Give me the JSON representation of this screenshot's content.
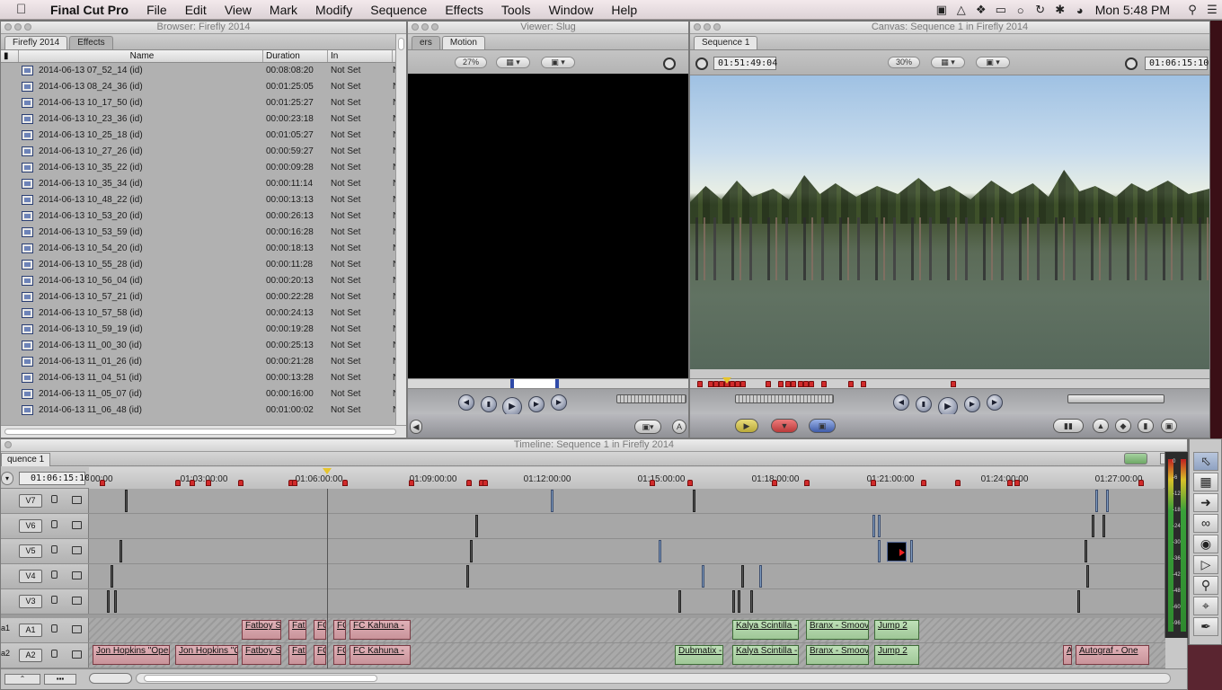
{
  "menubar": {
    "app_name": "Final Cut Pro",
    "items": [
      "File",
      "Edit",
      "View",
      "Mark",
      "Modify",
      "Sequence",
      "Effects",
      "Tools",
      "Window",
      "Help"
    ],
    "clock": "Mon 5:48 PM"
  },
  "browser": {
    "title": "Browser: Firefly 2014",
    "tabs": [
      "Firefly 2014",
      "Effects"
    ],
    "columns": [
      "Name",
      "Duration",
      "In"
    ],
    "rows": [
      {
        "name": "2014-06-13 07_52_14 (id)",
        "duration": "00:08:08:20",
        "in": "Not Set"
      },
      {
        "name": "2014-06-13 08_24_36 (id)",
        "duration": "00:01:25:05",
        "in": "Not Set"
      },
      {
        "name": "2014-06-13 10_17_50 (id)",
        "duration": "00:01:25:27",
        "in": "Not Set"
      },
      {
        "name": "2014-06-13 10_23_36 (id)",
        "duration": "00:00:23:18",
        "in": "Not Set"
      },
      {
        "name": "2014-06-13 10_25_18 (id)",
        "duration": "00:01:05:27",
        "in": "Not Set"
      },
      {
        "name": "2014-06-13 10_27_26 (id)",
        "duration": "00:00:59:27",
        "in": "Not Set"
      },
      {
        "name": "2014-06-13 10_35_22 (id)",
        "duration": "00:00:09:28",
        "in": "Not Set"
      },
      {
        "name": "2014-06-13 10_35_34 (id)",
        "duration": "00:00:11:14",
        "in": "Not Set"
      },
      {
        "name": "2014-06-13 10_48_22 (id)",
        "duration": "00:00:13:13",
        "in": "Not Set"
      },
      {
        "name": "2014-06-13 10_53_20 (id)",
        "duration": "00:00:26:13",
        "in": "Not Set"
      },
      {
        "name": "2014-06-13 10_53_59 (id)",
        "duration": "00:00:16:28",
        "in": "Not Set"
      },
      {
        "name": "2014-06-13 10_54_20 (id)",
        "duration": "00:00:18:13",
        "in": "Not Set"
      },
      {
        "name": "2014-06-13 10_55_28 (id)",
        "duration": "00:00:11:28",
        "in": "Not Set"
      },
      {
        "name": "2014-06-13 10_56_04 (id)",
        "duration": "00:00:20:13",
        "in": "Not Set"
      },
      {
        "name": "2014-06-13 10_57_21 (id)",
        "duration": "00:00:22:28",
        "in": "Not Set"
      },
      {
        "name": "2014-06-13 10_57_58 (id)",
        "duration": "00:00:24:13",
        "in": "Not Set"
      },
      {
        "name": "2014-06-13 10_59_19 (id)",
        "duration": "00:00:19:28",
        "in": "Not Set"
      },
      {
        "name": "2014-06-13 11_00_30 (id)",
        "duration": "00:00:25:13",
        "in": "Not Set"
      },
      {
        "name": "2014-06-13 11_01_26 (id)",
        "duration": "00:00:21:28",
        "in": "Not Set"
      },
      {
        "name": "2014-06-13 11_04_51 (id)",
        "duration": "00:00:13:28",
        "in": "Not Set"
      },
      {
        "name": "2014-06-13 11_05_07 (id)",
        "duration": "00:00:16:00",
        "in": "Not Set"
      },
      {
        "name": "2014-06-13 11_06_48 (id)",
        "duration": "00:01:00:02",
        "in": "Not Set"
      }
    ]
  },
  "viewer": {
    "title": "Viewer: Slug",
    "tabs": [
      "ers",
      "Motion"
    ],
    "zoom": "27%"
  },
  "canvas": {
    "title": "Canvas: Sequence 1 in Firefly 2014",
    "tab": "Sequence 1",
    "timecode_in": "01:51:49:04",
    "zoom": "30%",
    "timecode_dur": "01:06:15:10"
  },
  "timeline": {
    "title": "Timeline: Sequence 1 in Firefly 2014",
    "tab": "quence 1",
    "current_timecode": "01:06:15:10",
    "ruler_labels": [
      "00:00",
      "01:03:00:00",
      "01:06:00:00",
      "01:09:00:00",
      "01:12:00:00",
      "01:15:00:00",
      "01:18:00:00",
      "01:21:00:00",
      "01:24:00:00",
      "01:27:00:00"
    ],
    "video_tracks": [
      "V7",
      "V6",
      "V5",
      "V4",
      "V3"
    ],
    "audio_tracks": [
      {
        "src": "a1",
        "dest": "A1"
      },
      {
        "src": "a2",
        "dest": "A2"
      }
    ],
    "a1_clips": [
      "Fatboy Sl",
      "Fatb",
      "FC",
      "FC",
      "FC Kahuna - ",
      "Kalya Scintilla -",
      "Branx - Smoov",
      "Jump 2"
    ],
    "a2_clips": [
      "Jon Hopkins \"Open",
      "Jon Hopkins \"O",
      "Fatboy Sl",
      "Fatb",
      "FC",
      "FC",
      "FC Kahuna - ",
      "Dubmatix -",
      "Kalya Scintilla -",
      "Branx - Smoov",
      "Jump 2",
      "A",
      "Autograf - One"
    ]
  },
  "meters": {
    "labels": [
      "0",
      "-6",
      "-12",
      "-18",
      "-24",
      "-30",
      "-36",
      "-42",
      "-48",
      "-60",
      "-96"
    ]
  },
  "colors": {
    "audio_clip": "#d9a9b0",
    "green_clip": "#b5d9ad",
    "marker": "#d12a2a",
    "playhead": "#e6c42d"
  }
}
